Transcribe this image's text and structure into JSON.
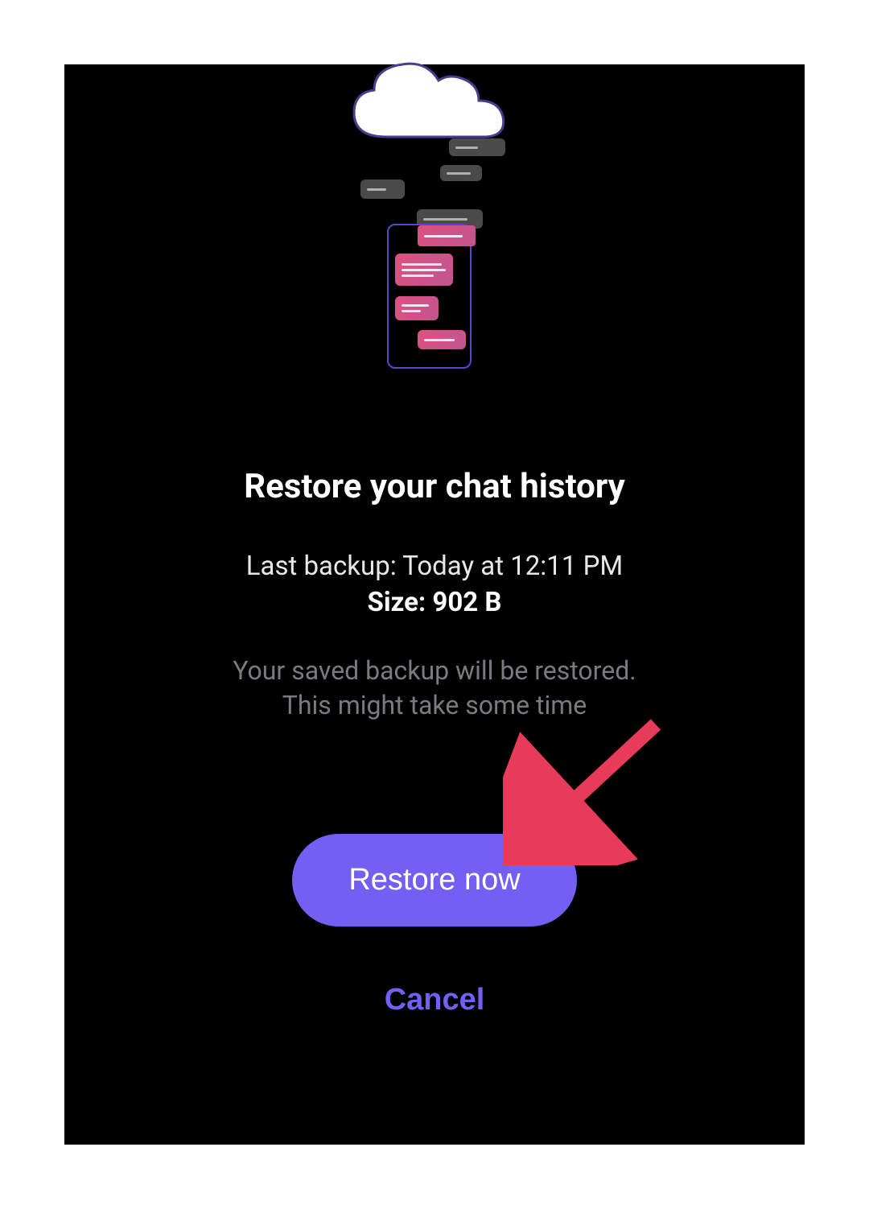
{
  "heading": "Restore your chat history",
  "backup": {
    "last_backup_label": "Last backup: Today at 12:11 PM",
    "size_label": "Size: 902 B"
  },
  "description": {
    "line1": "Your saved backup will be restored.",
    "line2": "This might take some time"
  },
  "buttons": {
    "restore": "Restore now",
    "cancel": "Cancel"
  },
  "colors": {
    "accent": "#7360f2",
    "background": "#000000"
  }
}
